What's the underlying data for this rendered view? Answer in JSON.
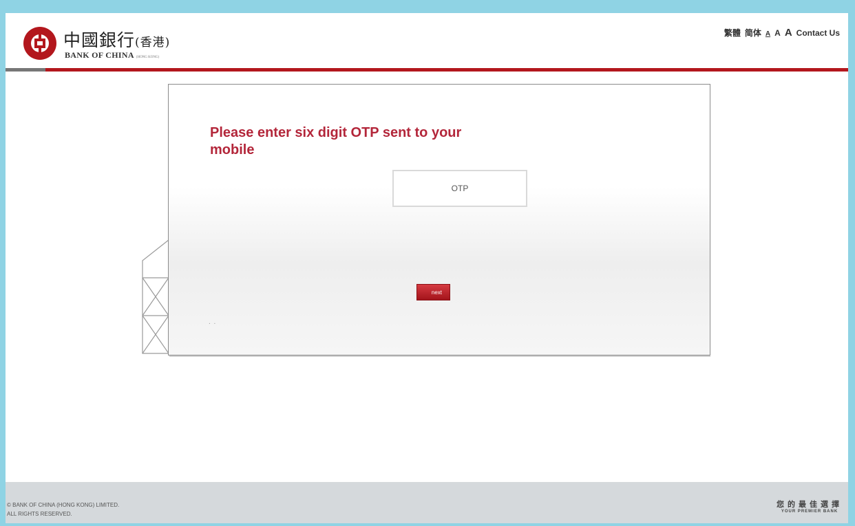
{
  "header": {
    "logo_cn": "中國銀行",
    "logo_cn_suffix": "(香港)",
    "logo_en": "BANK OF CHINA",
    "logo_en_sub": "(HONG KONG)",
    "lang_traditional": "繁體",
    "lang_simplified": "简体",
    "font_small": "A",
    "font_medium": "A",
    "font_large": "A",
    "contact_us": "Contact Us"
  },
  "main": {
    "title": "Please enter six digit OTP sent to your mobile",
    "otp_placeholder": "OTP",
    "next_label": "next",
    "dots": ". ."
  },
  "footer": {
    "copyright_line1": "© BANK OF CHINA (HONG KONG) LIMITED.",
    "copyright_line2": "ALL RIGHTS RESERVED.",
    "slogan_cn": "您的最佳選擇",
    "slogan_en": "YOUR PREMIER BANK"
  },
  "colors": {
    "brand_red": "#b3171d",
    "title_red": "#b3263a",
    "frame_blue": "#8fd3e4",
    "footer_gray": "#d5d9dc"
  }
}
